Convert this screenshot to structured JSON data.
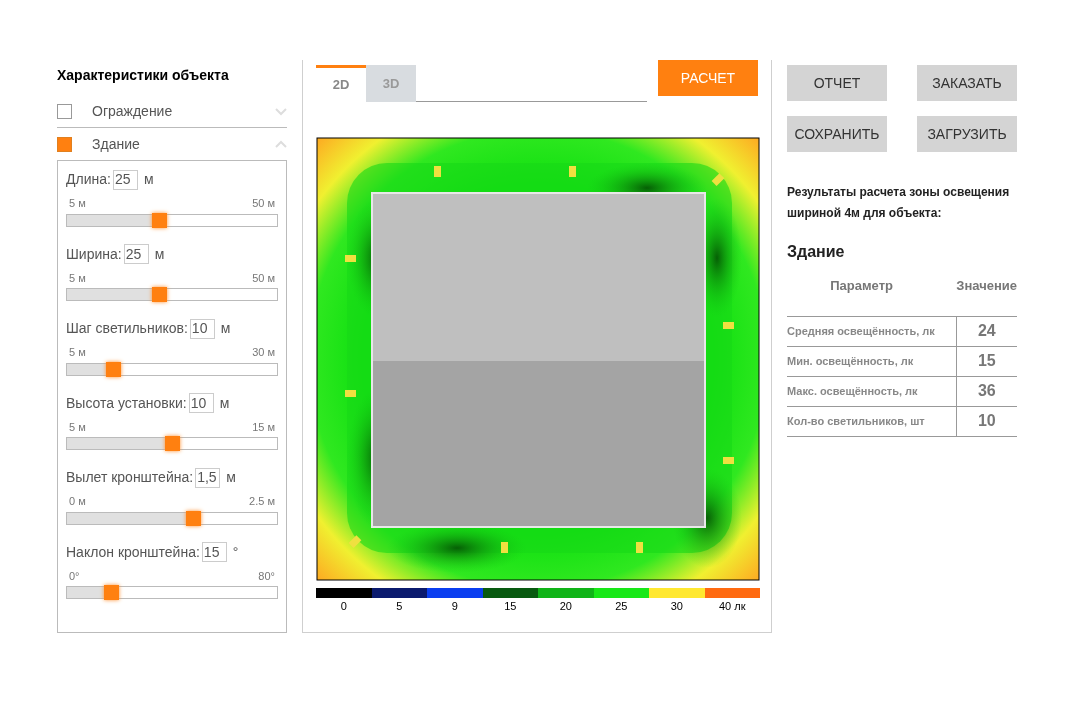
{
  "sidebar": {
    "title": "Характеристики объекта",
    "sections": [
      {
        "label": "Ограждение",
        "checked": false,
        "expanded": false
      },
      {
        "label": "Здание",
        "checked": true,
        "expanded": true,
        "params": [
          {
            "label": "Длина:",
            "value": "25",
            "unit": "м",
            "min": "5 м",
            "max": "50 м",
            "level": 0.44
          },
          {
            "label": "Ширина:",
            "value": "25",
            "unit": "м",
            "min": "5 м",
            "max": "50 м",
            "level": 0.44
          },
          {
            "label": "Шаг светильников:",
            "value": "10",
            "unit": "м",
            "min": "5 м",
            "max": "30 м",
            "level": 0.22
          },
          {
            "label": "Высота установки:",
            "value": "10",
            "unit": "м",
            "min": "5 м",
            "max": "15 м",
            "level": 0.5
          },
          {
            "label": "Вылет кронштейна:",
            "value": "1,5",
            "unit": "м",
            "min": "0 м",
            "max": "2.5 м",
            "level": 0.6
          },
          {
            "label": "Наклон кронштейна:",
            "value": "15",
            "unit": "°",
            "min": "0°",
            "max": "80°",
            "level": 0.21
          }
        ]
      }
    ]
  },
  "view_tabs": [
    {
      "label": "2D",
      "selected": true
    },
    {
      "label": "3D",
      "selected": false
    }
  ],
  "buttons": [
    {
      "label": "РАСЧЕТ",
      "kind": "primary"
    },
    {
      "label": "ОТЧЕТ",
      "kind": "secondary"
    },
    {
      "label": "ЗАКАЗАТЬ",
      "kind": "secondary"
    },
    {
      "label": "СОХРАНИТЬ",
      "kind": "secondary"
    },
    {
      "label": "ЗАГРУЗИТЬ",
      "kind": "secondary"
    }
  ],
  "legend": [
    {
      "label": "0",
      "color": "#000000"
    },
    {
      "label": "5",
      "color": "#0a1a6e"
    },
    {
      "label": "9",
      "color": "#0a3ef0"
    },
    {
      "label": "15",
      "color": "#085a10"
    },
    {
      "label": "20",
      "color": "#10b418"
    },
    {
      "label": "25",
      "color": "#18e818"
    },
    {
      "label": "30",
      "color": "#ffe830"
    },
    {
      "label": "40 лк",
      "color": "#ff6a10"
    }
  ],
  "results": {
    "caption": "Результаты расчета зоны освещения шириной 4м для объекта:",
    "object": "Здание",
    "columns": [
      "Параметр",
      "Значение"
    ],
    "rows": [
      [
        "Средняя освещённость, лк",
        "24"
      ],
      [
        "Мин. освещённость, лк",
        "15"
      ],
      [
        "Макс. освещённость, лк",
        "36"
      ],
      [
        "Кол-во светильников, шт",
        "10"
      ]
    ]
  }
}
